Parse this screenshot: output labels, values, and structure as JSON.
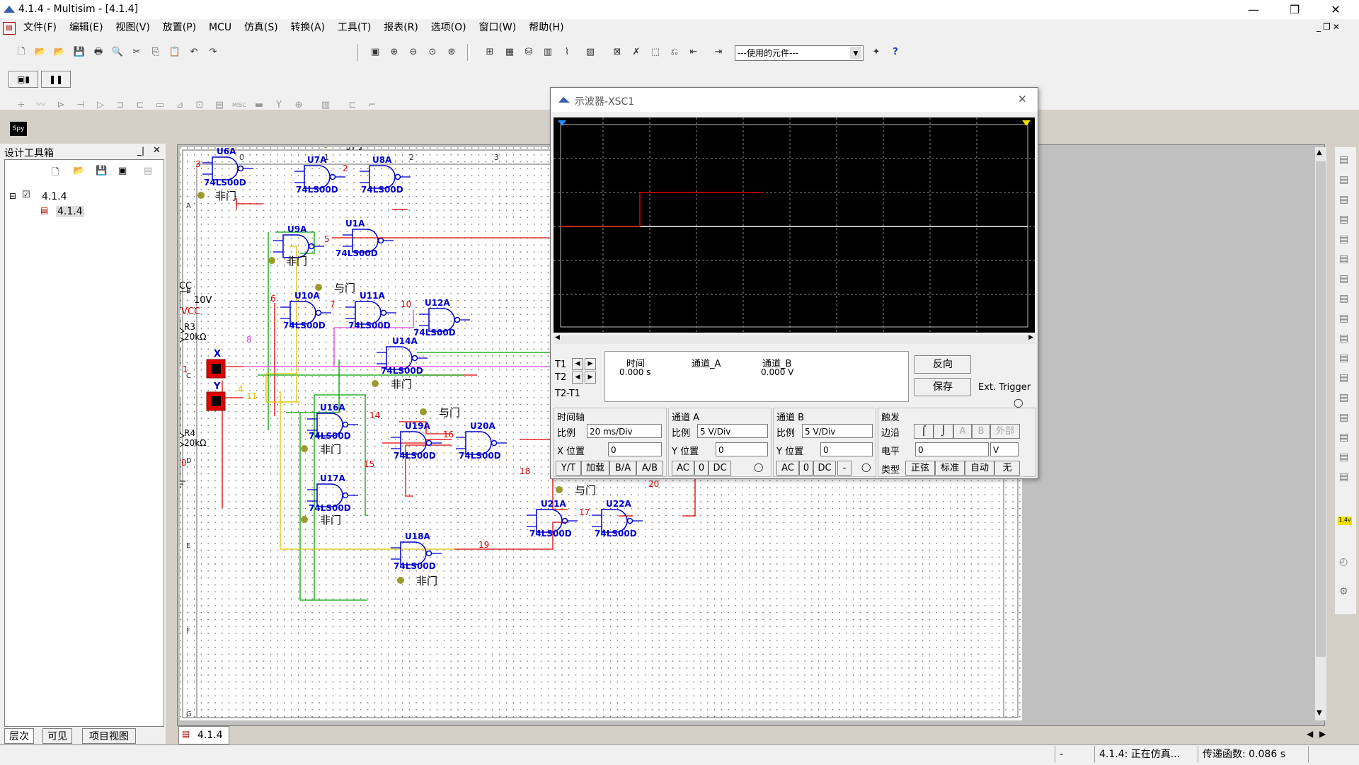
{
  "window": {
    "title": "4.1.4 - Multisim - [4.1.4]",
    "minimize": "—",
    "restore": "❐",
    "close": "✕"
  },
  "menu": [
    "文件(F)",
    "编辑(E)",
    "视图(V)",
    "放置(P)",
    "MCU",
    "仿真(S)",
    "转换(A)",
    "工具(T)",
    "报表(R)",
    "选项(O)",
    "窗口(W)",
    "帮助(H)"
  ],
  "toolbar": {
    "in_use_list": "---使用的元件---"
  },
  "design_toolbox": {
    "title": "设计工具箱",
    "tree": [
      {
        "label": "4.1.4"
      },
      {
        "label": "4.1.4"
      }
    ],
    "tabs": [
      "层次",
      "可见",
      "项目视图"
    ]
  },
  "sheet_tab": "4.1.4",
  "oscilloscope": {
    "title": "示波器-XSC1",
    "t1": "T1",
    "t2": "T2",
    "t2t1": "T2-T1",
    "col_time": "时间",
    "col_cha": "通道_A",
    "col_chb": "通道_B",
    "val_time": "0.000 s",
    "val_chb": "0.000 V",
    "reverse": "反向",
    "save": "保存",
    "ext_trigger": "Ext. Trigger",
    "timebase": {
      "title": "时间轴",
      "scale_label": "比例",
      "scale": "20 ms/Div",
      "xpos_label": "X 位置",
      "xpos": "0",
      "buttons": [
        "Y/T",
        "加载",
        "B/A",
        "A/B"
      ]
    },
    "channel_a": {
      "title": "通道 A",
      "scale_label": "比例",
      "scale": "5  V/Div",
      "ypos_label": "Y 位置",
      "ypos": "0",
      "buttons": [
        "AC",
        "0",
        "DC"
      ]
    },
    "channel_b": {
      "title": "通道 B",
      "scale_label": "比例",
      "scale": "5  V/Div",
      "ypos_label": "Y 位置",
      "ypos": "0",
      "buttons": [
        "AC",
        "0",
        "DC",
        "-"
      ]
    },
    "trigger": {
      "title": "触发",
      "edge_label": "边沿",
      "level_label": "电平",
      "level": "0",
      "level_unit": "V",
      "type_label": "类型",
      "edge_buttons": [
        "A",
        "B",
        "外部"
      ],
      "type_buttons": [
        "正弦",
        "标准",
        "自动",
        "无"
      ]
    }
  },
  "schematic": {
    "vcc_label": "VCC",
    "vcc_value": "10V",
    "vcc_net": "VCC",
    "r3": {
      "ref": "R3",
      "value": "20kΩ"
    },
    "r4": {
      "ref": "R4",
      "value": "20kΩ"
    },
    "switch_x": "X",
    "switch_y": "Y",
    "gate_part": "74LS00D",
    "ruler_top": [
      "0",
      "1",
      "2",
      "3"
    ],
    "ruler_left": [
      "A",
      "B",
      "C",
      "D",
      "E",
      "F",
      "G"
    ],
    "notes": {
      "and": "与门",
      "not": "非门"
    }
  },
  "status": {
    "dash": "-",
    "sim": "4.1.4: 正在仿真...",
    "transfer": "传递函数: 0.086 s"
  },
  "colors": {
    "wire_red": "#e00000",
    "wire_green": "#00a000",
    "wire_yellow": "#e0c000",
    "wire_magenta": "#e040e0",
    "gate_blue": "#0000cc",
    "scope_bg": "#000000"
  }
}
